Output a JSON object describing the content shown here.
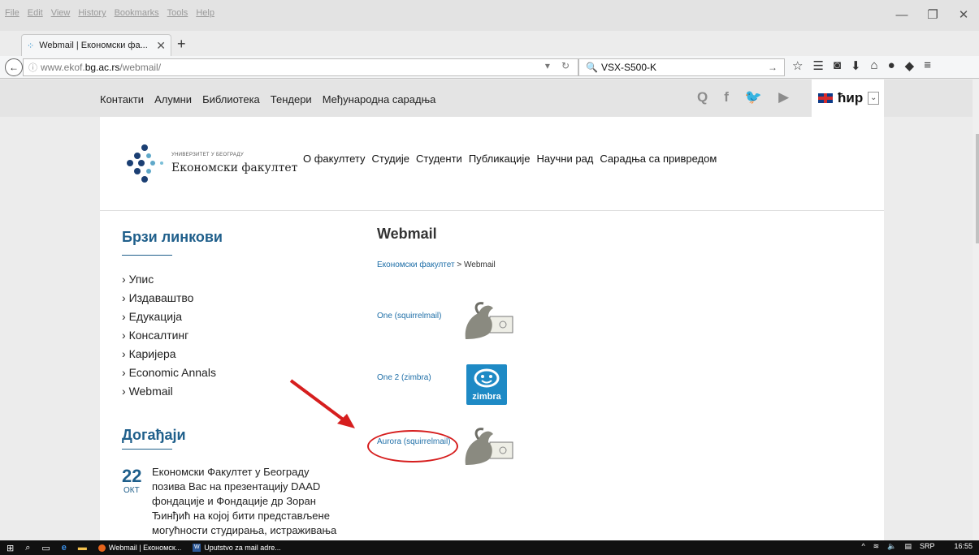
{
  "menu": [
    "File",
    "Edit",
    "View",
    "History",
    "Bookmarks",
    "Tools",
    "Help"
  ],
  "window": {
    "minimize": "—",
    "restore": "❐",
    "close": "✕"
  },
  "tab": {
    "title": "Webmail | Економски фа...",
    "close": "✕",
    "new_tab": "+"
  },
  "url": {
    "prefix": "www.ekof.",
    "domain": "bg.ac.rs",
    "path": "/webmail/"
  },
  "search": {
    "value": "VSX-S500-K"
  },
  "page": {
    "toplinks": [
      "Контакти",
      "Алумни",
      "Библиотека",
      "Тендери",
      "Међународна сарадња"
    ],
    "social": [
      "Q",
      "f",
      "🐦",
      "▶"
    ],
    "lang": {
      "label": "ћир",
      "arrow": "⌄"
    },
    "logo": {
      "small": "УНИВЕРЗИТЕТ У БЕОГРАДУ",
      "name": "Економски факултет"
    },
    "mainnav": [
      "О факултету",
      "Студије",
      "Студенти",
      "Публикације",
      "Научни рад",
      "Сарадња са привредом"
    ],
    "quick_links_title": "Брзи линкови",
    "quick_links": [
      "Упис",
      "Издаваштво",
      "Едукација",
      "Консалтинг",
      "Каријера",
      "Economic Annals",
      "Webmail"
    ],
    "events_title": "Догађаји",
    "event": {
      "day": "22",
      "month": "ОКТ",
      "text": "Економски Факултет у Београду позива Вас на презентацију DAAD фондације и Фондације др Зоран Ђинђић на којој бити представљене могућности студирања, истраживања"
    },
    "content_title": "Webmail",
    "breadcrumb": {
      "home": "Економски факултет",
      "sep": " > ",
      "current": "Webmail"
    },
    "mail_links": [
      "One (squirrelmail)",
      "One 2 (zimbra)",
      "Aurora (squirrelmail)"
    ],
    "zimbra_label": "zimbra"
  },
  "taskbar": {
    "apps": [
      "Webmail | Економск...",
      "Uputstvo za mail adre..."
    ],
    "lang": "SRP",
    "time": "16:55"
  },
  "colors": {
    "accent": "#1f5f8b",
    "link": "#1f6fa8",
    "annotation": "#d61e1e"
  }
}
